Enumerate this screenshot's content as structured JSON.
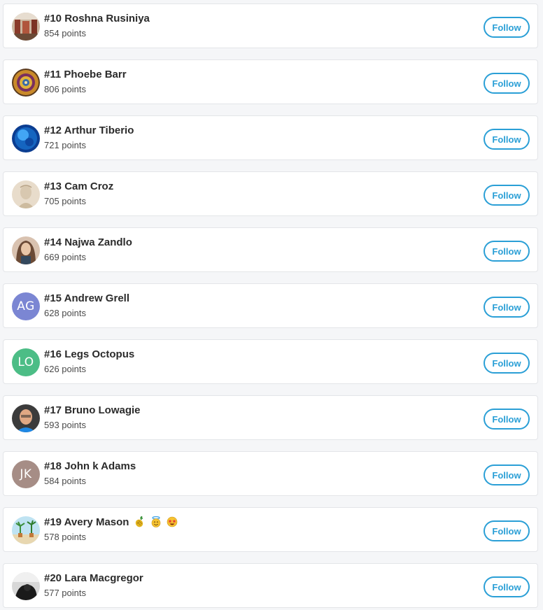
{
  "leaderboard": {
    "follow_label": "Follow",
    "entries": [
      {
        "rank_name": "#10 Roshna Rusiniya",
        "points": "854 points",
        "avatar": "photo"
      },
      {
        "rank_name": "#11 Phoebe Barr",
        "points": "806 points",
        "avatar": "photo"
      },
      {
        "rank_name": "#12 Arthur Tiberio",
        "points": "721 points",
        "avatar": "photo"
      },
      {
        "rank_name": "#13 Cam Croz",
        "points": "705 points",
        "avatar": "photo"
      },
      {
        "rank_name": "#14 Najwa Zandlo",
        "points": "669 points",
        "avatar": "photo"
      },
      {
        "rank_name": "#15 Andrew Grell",
        "points": "628 points",
        "avatar": "initials",
        "initials": "AG",
        "color": "#7b86d3"
      },
      {
        "rank_name": "#16 Legs Octopus",
        "points": "626 points",
        "avatar": "initials",
        "initials": "LO",
        "color": "#4cbd86"
      },
      {
        "rank_name": "#17 Bruno Lowagie",
        "points": "593 points",
        "avatar": "photo"
      },
      {
        "rank_name": "#18 John k Adams",
        "points": "584 points",
        "avatar": "initials",
        "initials": "JK",
        "color": "#a68d86"
      },
      {
        "rank_name": "#19 Avery Mason",
        "points": "578 points",
        "avatar": "photo",
        "emojis": [
          "pineapple-emoji",
          "halo-smile-emoji",
          "star-eyes-emoji"
        ]
      },
      {
        "rank_name": "#20 Lara Macgregor",
        "points": "577 points",
        "avatar": "photo"
      }
    ]
  },
  "colors": {
    "accent": "#2a9fd6",
    "card_background": "#ffffff",
    "page_background": "#f5f6f8"
  }
}
